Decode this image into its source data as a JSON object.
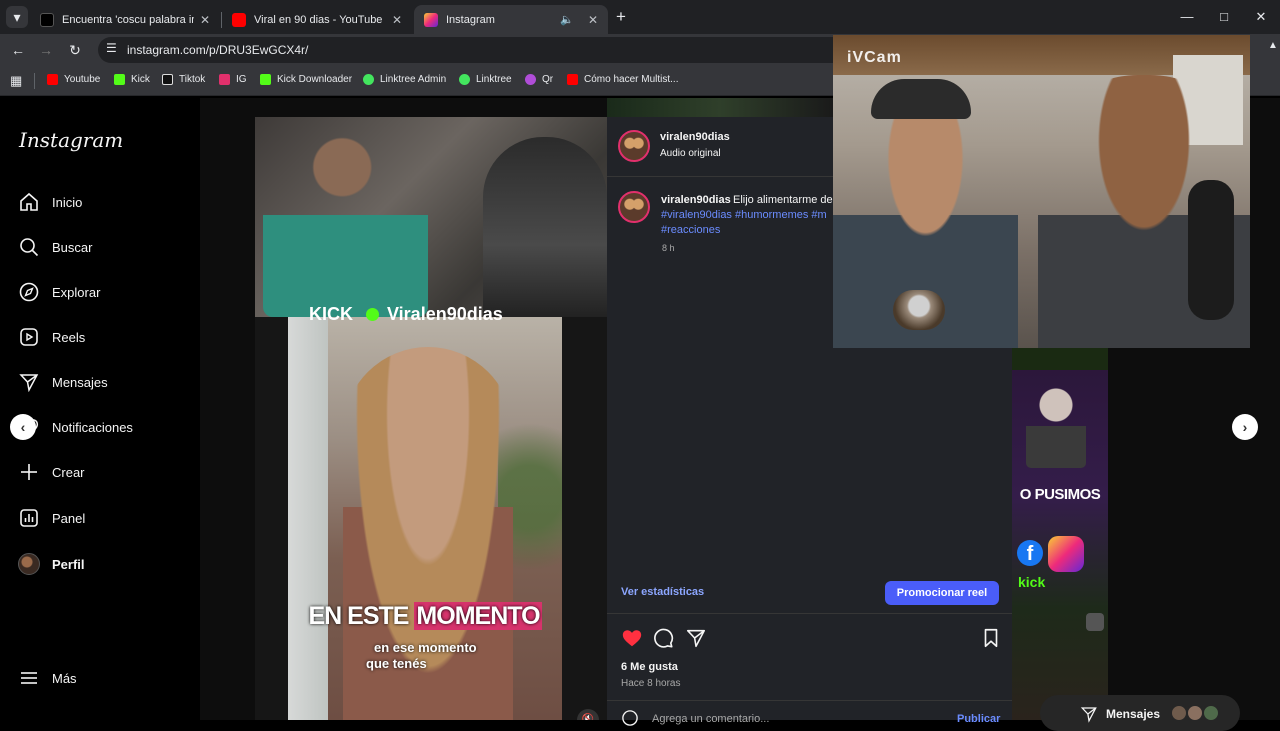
{
  "browser": {
    "tabs": [
      {
        "label": "Encuentra 'coscu palabra inventada'",
        "favicon": "tiktok-icon",
        "active": false
      },
      {
        "label": "Viral en 90 dias - YouTube",
        "favicon": "youtube-icon",
        "active": false
      },
      {
        "label": "Instagram",
        "favicon": "instagram-icon",
        "active": true
      }
    ],
    "new_tab": "+",
    "url": "instagram.com/p/DRU3EwGCX4r/",
    "bookmarks": [
      {
        "label": "Youtube",
        "icon": "youtube-icon",
        "color": "#ff0000"
      },
      {
        "label": "Kick",
        "icon": "kick-icon",
        "color": "#53fc18"
      },
      {
        "label": "Tiktok",
        "icon": "tiktok-icon",
        "color": "#ffffff"
      },
      {
        "label": "IG",
        "icon": "instagram-icon",
        "color": "#e1306c"
      },
      {
        "label": "Kick Downloader",
        "icon": "kick-downloader-icon",
        "color": "#53fc18"
      },
      {
        "label": "Linktree Admin",
        "icon": "linktree-icon",
        "color": "#43e55e"
      },
      {
        "label": "Linktree",
        "icon": "linktree-icon",
        "color": "#43e55e"
      },
      {
        "label": "Qr",
        "icon": "qr-icon",
        "color": "#b04dd8"
      },
      {
        "label": "Cómo hacer Multist...",
        "icon": "youtube-icon",
        "color": "#ff0000"
      }
    ]
  },
  "instagram": {
    "logo": "Instagram",
    "nav": [
      {
        "label": "Inicio",
        "icon": "home-icon"
      },
      {
        "label": "Buscar",
        "icon": "search-icon"
      },
      {
        "label": "Explorar",
        "icon": "compass-icon"
      },
      {
        "label": "Reels",
        "icon": "reels-icon"
      },
      {
        "label": "Mensajes",
        "icon": "send-icon"
      },
      {
        "label": "Notificaciones",
        "icon": "heart-icon"
      },
      {
        "label": "Crear",
        "icon": "plus-icon"
      },
      {
        "label": "Panel",
        "icon": "dashboard-icon"
      },
      {
        "label": "Perfil",
        "icon": "avatar"
      }
    ],
    "more": "Más"
  },
  "video": {
    "banner_kick": "KICK",
    "banner_name": "Viralen90dias",
    "caption_main_1": "EN ESTE",
    "caption_main_2": "MOMENTO",
    "caption_sub_1": "en ese momento",
    "caption_sub_2": "que tenés"
  },
  "post": {
    "username": "viralen90dias",
    "audio": "Audio original",
    "caption_user": "viralen90dias",
    "caption_text": "Elijo alimentarme de",
    "hashtags_line1": "#viralen90dias #humormemes #m",
    "hashtags_line2": "#reacciones",
    "caption_time": "8 h",
    "stats_link": "Ver estadísticas",
    "promote_button": "Promocionar reel",
    "likes": "6 Me gusta",
    "time": "Hace 8 horas",
    "comment_placeholder": "Agrega un comentario...",
    "publish": "Publicar"
  },
  "background_reel": {
    "headline": "O PUSIMOS",
    "kick_text": "kick"
  },
  "webcam": {
    "label": "iVCam"
  },
  "messages_bar": {
    "label": "Mensajes"
  },
  "colors": {
    "like_red": "#ff3040",
    "link_blue": "#6b8cff",
    "promote_blue": "#4a5df9"
  }
}
